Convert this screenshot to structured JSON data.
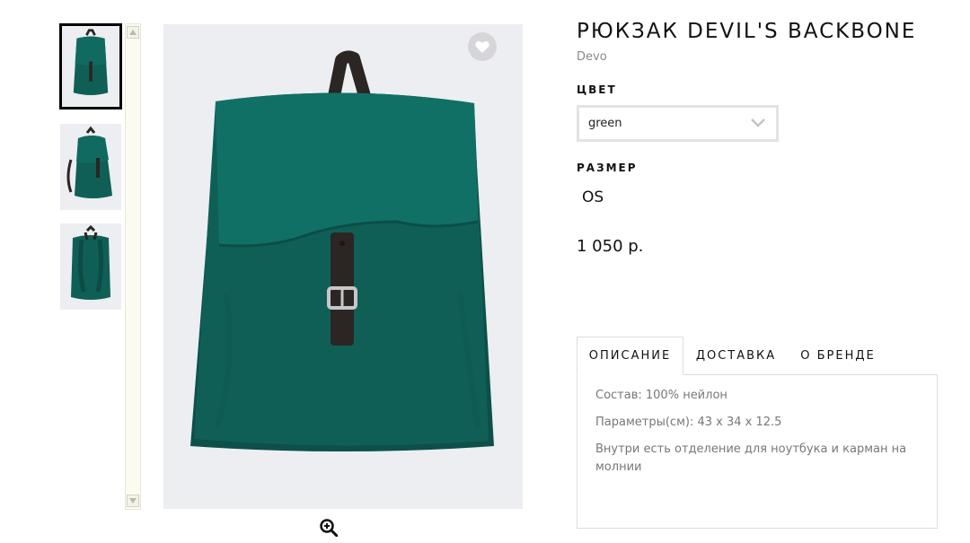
{
  "product": {
    "title": "РЮКЗАК DEVIL'S BACKBONE",
    "brand": "Devo",
    "price": "1 050 р."
  },
  "color": {
    "label": "ЦВЕТ",
    "selected": "green"
  },
  "size": {
    "label": "РАЗМЕР",
    "value": "OS"
  },
  "tabs": {
    "items": [
      {
        "label": "ОПИСАНИЕ",
        "active": true
      },
      {
        "label": "ДОСТАВКА",
        "active": false
      },
      {
        "label": "О БРЕНДЕ",
        "active": false
      }
    ],
    "description": [
      "Состав: 100% нейлон",
      "Параметры(см): 43 x 34 x 12.5",
      "Внутри есть отделение для ноутбука и карман на молнии"
    ]
  },
  "gallery": {
    "thumbnails": [
      "front-view",
      "side-view",
      "back-view"
    ],
    "selected_index": 0
  },
  "icons": {
    "wishlist": "heart-icon",
    "zoom": "zoom-in-icon",
    "dropdown": "chevron-down-icon"
  },
  "colors": {
    "bag_green": "#0f5f56",
    "strap_dark": "#2b2523",
    "image_bg": "#eceef2"
  }
}
